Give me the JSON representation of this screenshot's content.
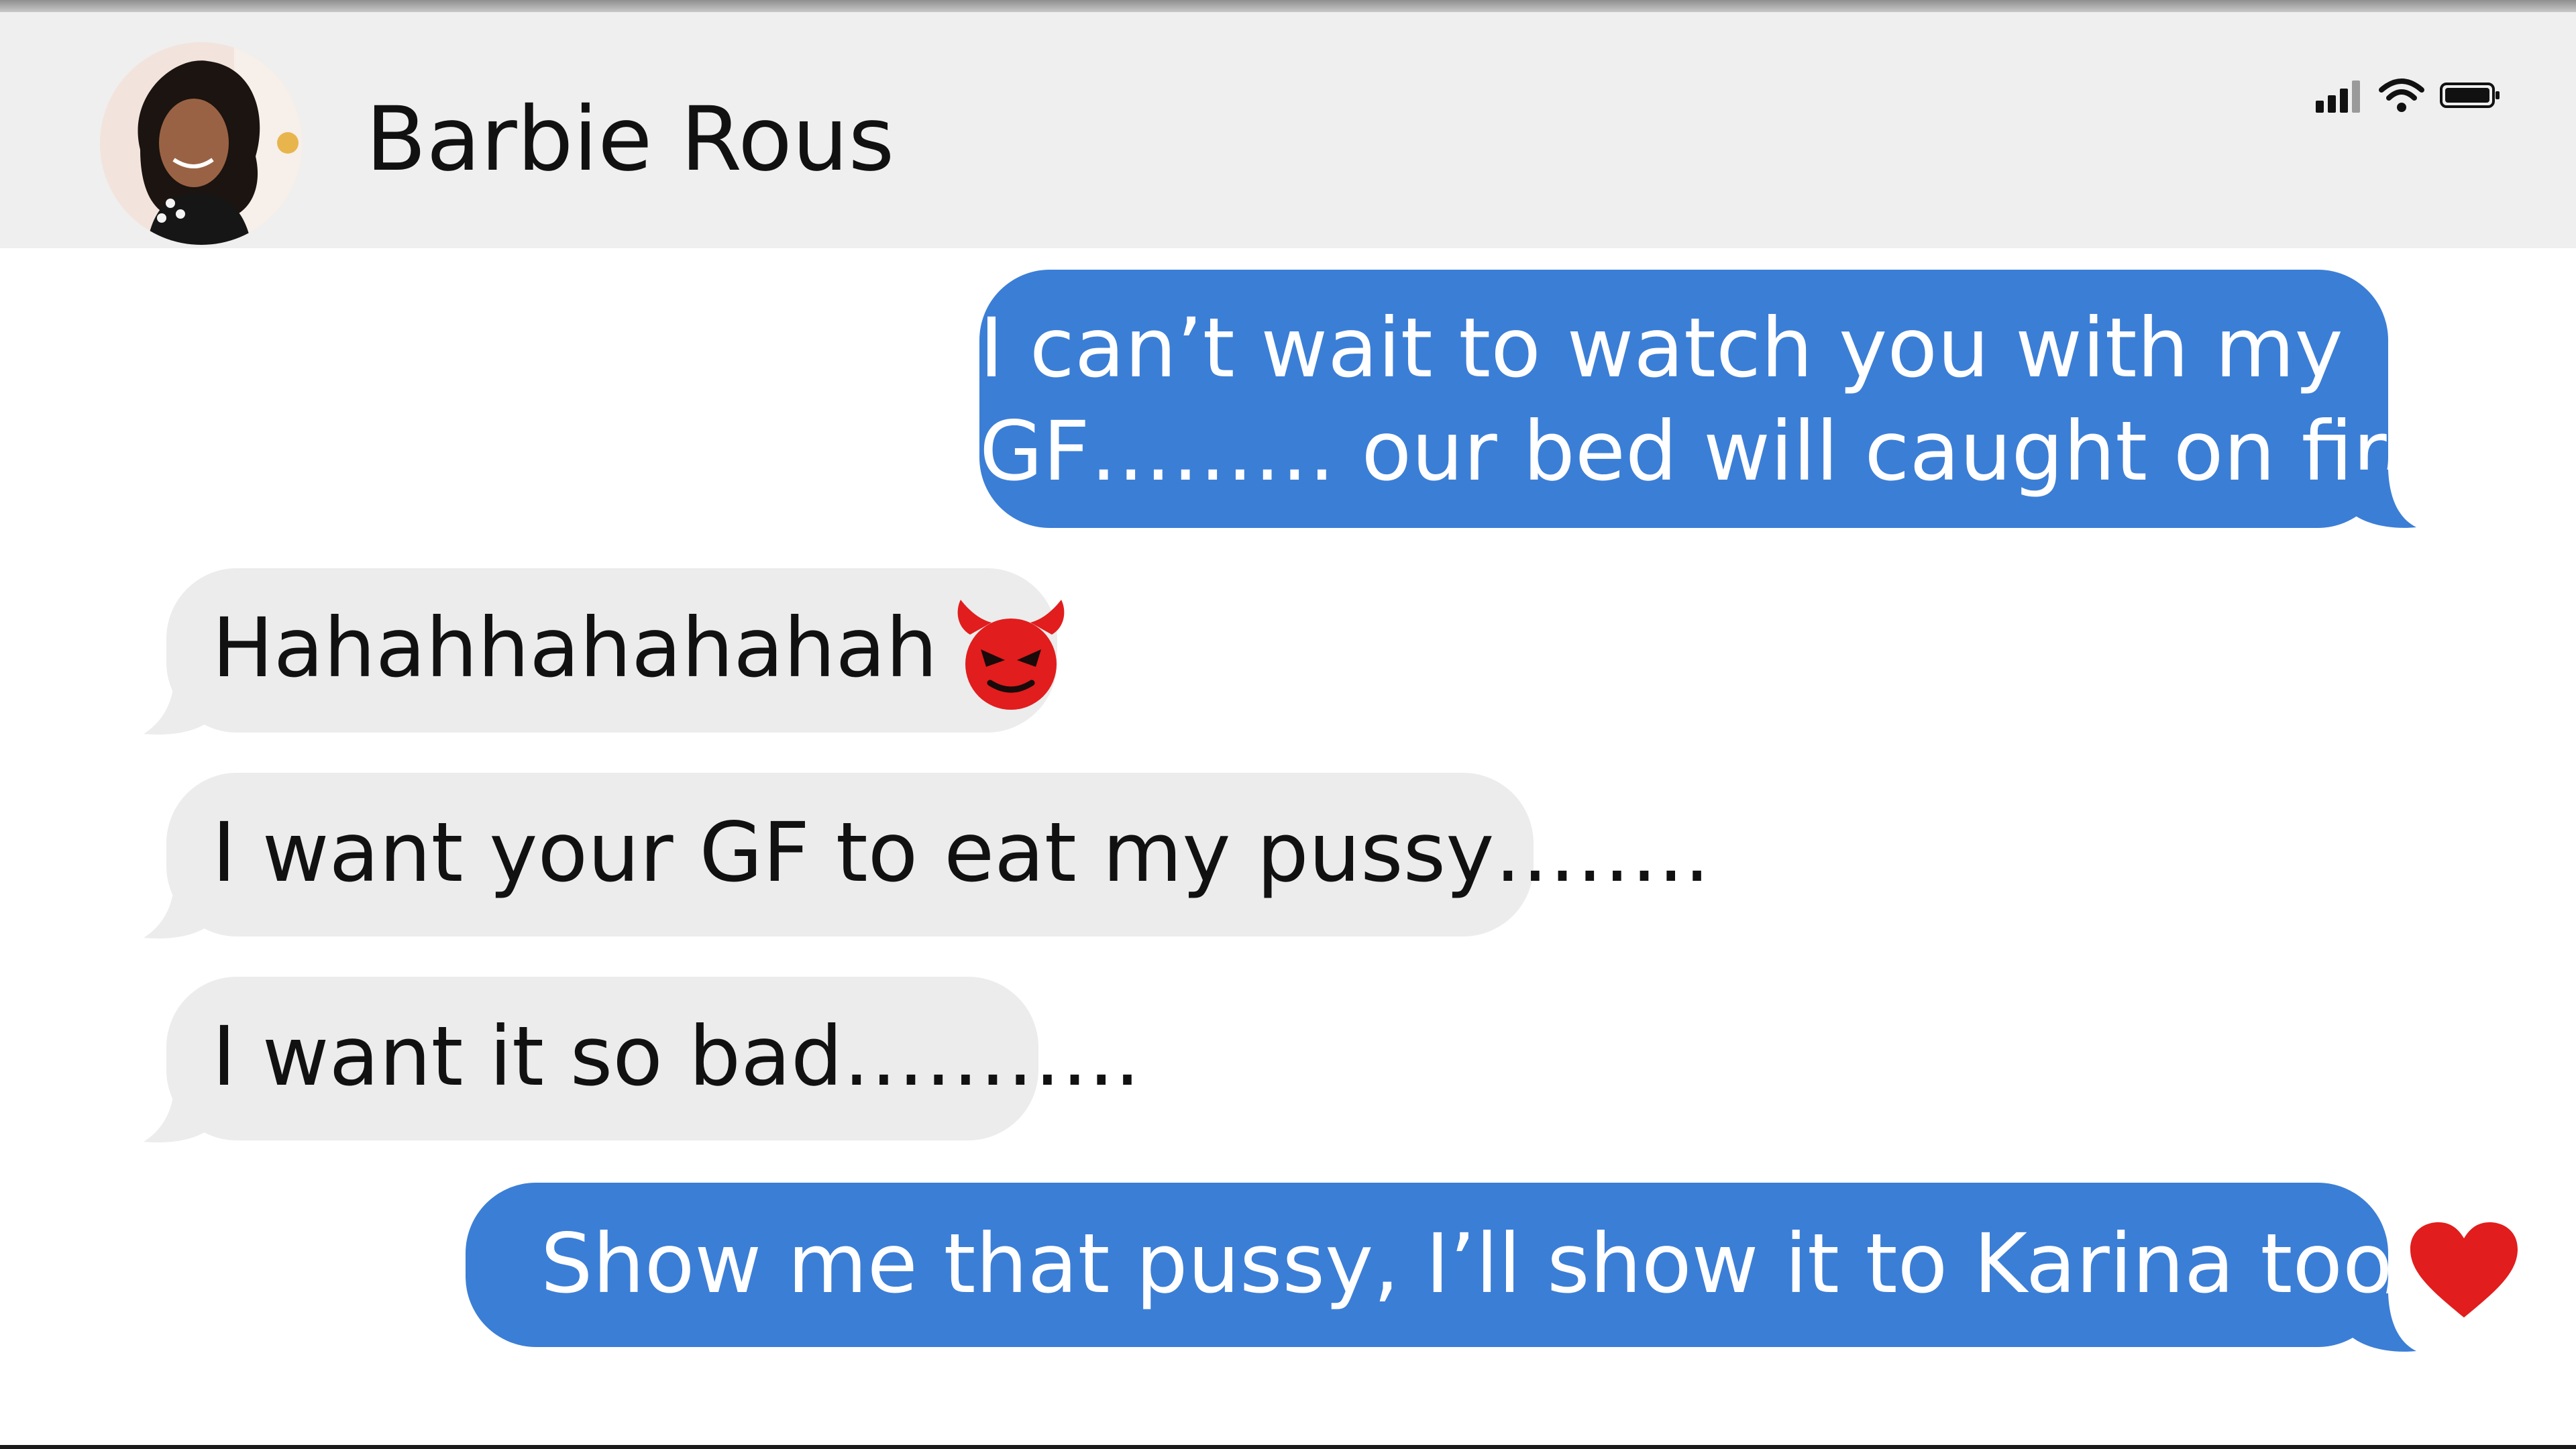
{
  "header": {
    "contact_name": "Barbie Rous",
    "avatar_icon": "contact-photo",
    "status_icons": [
      "cellular-signal-icon",
      "wifi-icon",
      "battery-icon"
    ]
  },
  "colors": {
    "header_bg": "#efefef",
    "outgoing_bubble": "#3b7ed6",
    "incoming_bubble": "#ececec",
    "emoji_red": "#e11d1d"
  },
  "messages": [
    {
      "direction": "outgoing",
      "lines": [
        "I can’t wait to watch you with my",
        "GF……… our bed will caught on fire"
      ]
    },
    {
      "direction": "incoming",
      "text": "Hahahhahahahah",
      "emoji": "devil-face-icon"
    },
    {
      "direction": "incoming",
      "text": "I want your GF to eat my pussy…….."
    },
    {
      "direction": "incoming",
      "text": "I want it so bad……….."
    },
    {
      "direction": "outgoing",
      "text": "Show me that pussy, I’ll show it to Karina too",
      "emoji": "red-heart-icon"
    }
  ]
}
